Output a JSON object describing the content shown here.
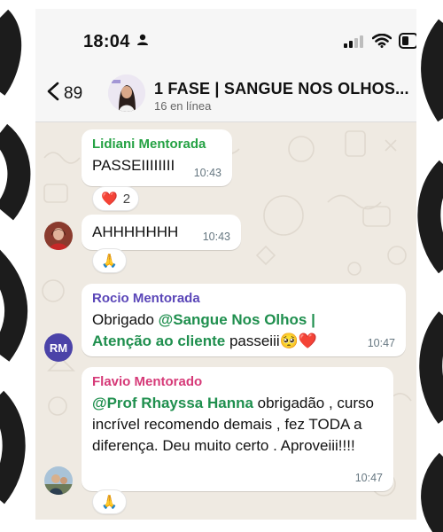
{
  "status_bar": {
    "time": "18:04"
  },
  "header": {
    "back_count": "89",
    "title": "1 FASE | SANGUE NOS OLHOS...",
    "subtitle": "16 en línea"
  },
  "colors": {
    "chat_bg": "#efeae2",
    "mention": "#1f8f4e",
    "lidiani": "#25a244",
    "rocio": "#5a46b8",
    "flavio": "#d63a78"
  },
  "messages": [
    {
      "sender": "Lidiani Mentorada",
      "text": "PASSEIIIIIIII",
      "time": "10:43",
      "reaction": {
        "emoji": "❤️",
        "count": "2"
      }
    },
    {
      "text": "AHHHHHHH",
      "time": "10:43",
      "reaction": {
        "emoji": "🙏"
      }
    },
    {
      "sender": "Rocio Mentorada",
      "avatar_initials": "RM",
      "prefix": "Obrigado ",
      "mention": "@Sangue Nos Olhos | Atenção ao cliente",
      "suffix": "  passeiii🥺❤️",
      "time": "10:47"
    },
    {
      "sender": "Flavio Mentorado",
      "mention": "@Prof Rhayssa Hanna",
      "suffix": " obrigadão , curso incrível recomendo demais , fez TODA a diferença. Deu muito certo . Aproveiii!!!!",
      "time": "10:47",
      "reaction": {
        "emoji": "🙏"
      }
    }
  ]
}
